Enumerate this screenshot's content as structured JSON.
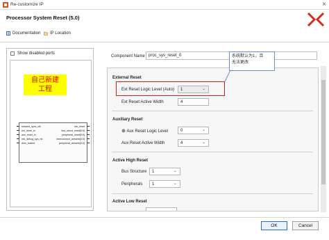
{
  "window": {
    "title": "Re-customize IP",
    "close_glyph": "×"
  },
  "header": {
    "dialog_title": "Processor System Reset (5.0)",
    "links": [
      {
        "label": "Documentation",
        "icon": "book-icon"
      },
      {
        "label": "IP Location",
        "icon": "folder-icon"
      }
    ]
  },
  "left": {
    "show_disabled_ports": "Show disabled ports",
    "note": "自己新建\n工程",
    "block": {
      "inputs": [
        "slowest_sync_clk",
        "ext_reset_in",
        "aux_reset_in",
        "mb_debug_sys_rst",
        "dcm_locked"
      ],
      "outputs": [
        "mb_reset",
        "bus_struct_reset[0:0]",
        "peripheral_reset[0:0]",
        "interconnect_aresetn[0:0]",
        "peripheral_aresetn[0:0]"
      ]
    }
  },
  "component": {
    "label": "Component Name",
    "value": "proc_sys_reset_0"
  },
  "callout": {
    "text": "系统默认为1，且\n无法更改"
  },
  "sections": {
    "external": {
      "title": "External Reset",
      "logic_level_label": "Ext Reset Logic Level (Auto)",
      "logic_level_value": "1",
      "active_width_label": "Ext Reset Active Width",
      "active_width_value": "4"
    },
    "auxiliary": {
      "title": "Auxiliary Reset",
      "logic_level_label": "Aux Reset Logic Level",
      "logic_level_value": "0",
      "active_width_label": "Aux Reset Active Width",
      "active_width_value": "4"
    },
    "active_high": {
      "title": "Active High Reset",
      "bus_structure_label": "Bus Structure",
      "bus_structure_value": "1",
      "peripherals_label": "Peripherals",
      "peripherals_value": "1"
    },
    "active_low": {
      "title": "Active Low Reset"
    }
  },
  "footer": {
    "ok": "OK",
    "cancel": "Cancel"
  },
  "colors": {
    "accent": "#2e69c7",
    "highlight": "#e11111",
    "note_bg": "#ffff00",
    "note_text": "#e60000"
  }
}
